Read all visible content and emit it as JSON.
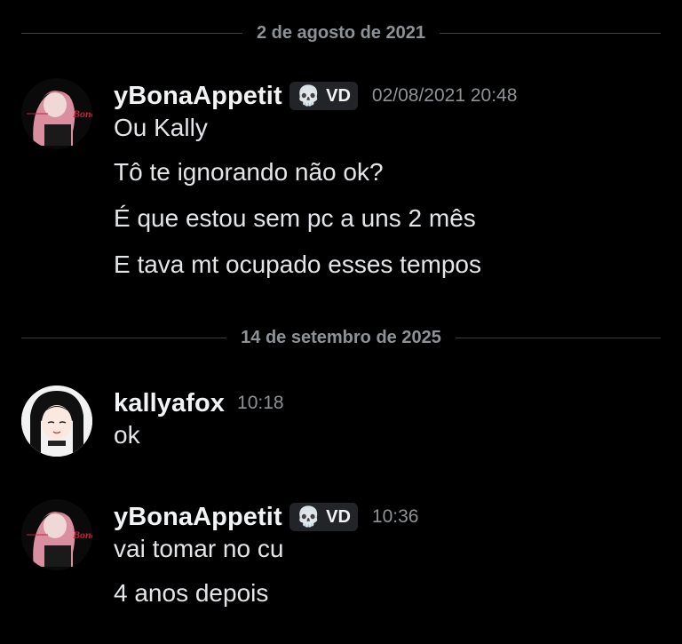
{
  "dividers": {
    "first": "2 de agosto de 2021",
    "second": "14 de setembro de 2025"
  },
  "groups": [
    {
      "username": "yBonaAppetit",
      "tag": {
        "icon": "skull-icon",
        "glyph": "💀",
        "text": "VD"
      },
      "timestamp": "02/08/2021 20:48",
      "lines": [
        "Ou Kally",
        "Tô te ignorando não ok?",
        "É que estou sem pc a uns 2 mês",
        "E tava mt ocupado esses tempos"
      ]
    },
    {
      "username": "kallyafox",
      "timestamp": "10:18",
      "lines": [
        "ok"
      ]
    },
    {
      "username": "yBonaAppetit",
      "tag": {
        "icon": "skull-icon",
        "glyph": "💀",
        "text": "VD"
      },
      "timestamp": "10:36",
      "lines": [
        "vai tomar no cu",
        "4 anos depois"
      ]
    }
  ],
  "avatar_logo_text": "Bona",
  "colors": {
    "background": "#000000",
    "username": "#f2f3f5",
    "timestamp": "#8e9297",
    "divider_line": "#3b3d44",
    "tag_background": "#232428"
  }
}
